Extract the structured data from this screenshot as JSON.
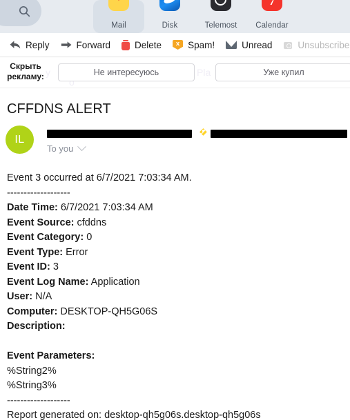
{
  "service_bar": {
    "search_icon": "search-icon",
    "services": [
      {
        "label": "Mail",
        "icon": "mail-icon",
        "active": true
      },
      {
        "label": "Disk",
        "icon": "disk-icon",
        "active": false
      },
      {
        "label": "Telemost",
        "icon": "telemost-icon",
        "active": false
      },
      {
        "label": "Calendar",
        "icon": "calendar-icon",
        "active": false,
        "badge": "7"
      }
    ]
  },
  "toolbar": {
    "reply": "Reply",
    "forward": "Forward",
    "delete": "Delete",
    "spam": "Spam!",
    "spam_glyph": "x",
    "unread": "Unread",
    "unsubscribe": "Unsubscribe"
  },
  "ad_row": {
    "label": "Скрыть\nрекламу:",
    "button_not_interested": "Не интересуюсь",
    "button_already_bought": "Уже купил",
    "ghost_text_1": "у",
    "ghost_text_2": "Pla",
    "ghost_text_3": "о"
  },
  "message": {
    "subject": "CFFDNS ALERT",
    "avatar_initials": "IL",
    "avatar_color": "#b0d318",
    "recipients": "To you",
    "sender_redacted": true,
    "subject_redacted": true,
    "tag_icon": "label-tag-icon",
    "body_lines": [
      {
        "text": "Event 3 occurred at 6/7/2021 7:03:34 AM.",
        "bold_prefix": ""
      },
      {
        "text": "-------------------",
        "bold_prefix": ""
      },
      {
        "bold_prefix": "Date Time:",
        "text": " 6/7/2021 7:03:34 AM"
      },
      {
        "bold_prefix": "Event Source:",
        "text": " cfddns"
      },
      {
        "bold_prefix": "Event Category:",
        "text": " 0"
      },
      {
        "bold_prefix": "Event Type:",
        "text": " Error"
      },
      {
        "bold_prefix": "Event ID:",
        "text": " 3"
      },
      {
        "bold_prefix": "Event Log Name:",
        "text": " Application"
      },
      {
        "bold_prefix": "User:",
        "text": " N/A"
      },
      {
        "bold_prefix": "Computer:",
        "text": " DESKTOP-QH5G06S"
      },
      {
        "bold_prefix": "Description:",
        "text": ""
      },
      {
        "bold_prefix": "",
        "text": ""
      },
      {
        "bold_prefix": "Event Parameters:",
        "text": ""
      },
      {
        "bold_prefix": "",
        "text": "%String2%"
      },
      {
        "bold_prefix": "",
        "text": "%String3%"
      },
      {
        "bold_prefix": "",
        "text": "-------------------"
      },
      {
        "bold_prefix": "",
        "text": "Report generated on: desktop-qh5g06s.desktop-qh5g06s"
      }
    ]
  }
}
